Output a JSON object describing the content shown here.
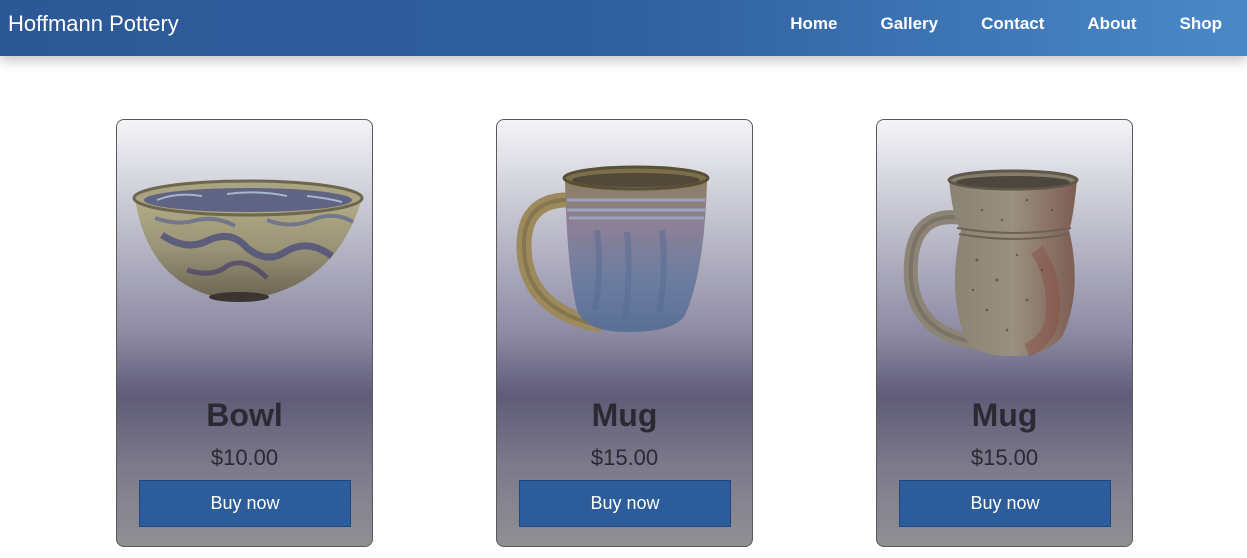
{
  "header": {
    "brand": "Hoffmann Pottery",
    "nav": [
      "Home",
      "Gallery",
      "Contact",
      "About",
      "Shop"
    ]
  },
  "products": [
    {
      "name": "Bowl",
      "price": "$10.00",
      "button": "Buy now",
      "image": "blue-glazed-bowl"
    },
    {
      "name": "Mug",
      "price": "$15.00",
      "button": "Buy now",
      "image": "blue-drip-glazed-mug"
    },
    {
      "name": "Mug",
      "price": "$15.00",
      "button": "Buy now",
      "image": "speckled-stoneware-mug"
    }
  ],
  "colors": {
    "nav_start": "#2d5896",
    "nav_end": "#4a89c9",
    "button": "#2d5c9a",
    "text_dark": "#2b2a33"
  }
}
